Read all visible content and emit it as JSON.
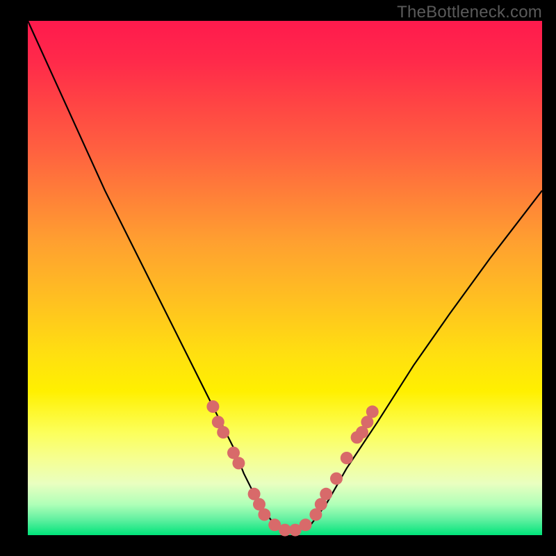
{
  "watermark": "TheBottleneck.com",
  "colors": {
    "marker": "#d86a6a",
    "curve": "#000000",
    "frame_bg": "#000000"
  },
  "chart_data": {
    "type": "line",
    "title": "",
    "xlabel": "",
    "ylabel": "",
    "xlim": [
      0,
      100
    ],
    "ylim": [
      0,
      100
    ],
    "grid": false,
    "legend": false,
    "series": [
      {
        "name": "bottleneck-curve",
        "x": [
          0,
          5,
          10,
          15,
          20,
          25,
          30,
          35,
          40,
          42,
          45,
          48,
          50,
          52,
          55,
          58,
          62,
          68,
          75,
          82,
          90,
          100
        ],
        "y": [
          100,
          89,
          78,
          67,
          57,
          47,
          37,
          27,
          17,
          12,
          6,
          2,
          1,
          1,
          2,
          6,
          13,
          22,
          33,
          43,
          54,
          67
        ]
      }
    ],
    "markers": {
      "name": "highlight-points",
      "points": [
        {
          "x": 36,
          "y": 25
        },
        {
          "x": 37,
          "y": 22
        },
        {
          "x": 38,
          "y": 20
        },
        {
          "x": 40,
          "y": 16
        },
        {
          "x": 41,
          "y": 14
        },
        {
          "x": 44,
          "y": 8
        },
        {
          "x": 45,
          "y": 6
        },
        {
          "x": 46,
          "y": 4
        },
        {
          "x": 48,
          "y": 2
        },
        {
          "x": 50,
          "y": 1
        },
        {
          "x": 52,
          "y": 1
        },
        {
          "x": 54,
          "y": 2
        },
        {
          "x": 56,
          "y": 4
        },
        {
          "x": 57,
          "y": 6
        },
        {
          "x": 58,
          "y": 8
        },
        {
          "x": 60,
          "y": 11
        },
        {
          "x": 62,
          "y": 15
        },
        {
          "x": 64,
          "y": 19
        },
        {
          "x": 65,
          "y": 20
        },
        {
          "x": 66,
          "y": 22
        },
        {
          "x": 67,
          "y": 24
        }
      ]
    }
  }
}
